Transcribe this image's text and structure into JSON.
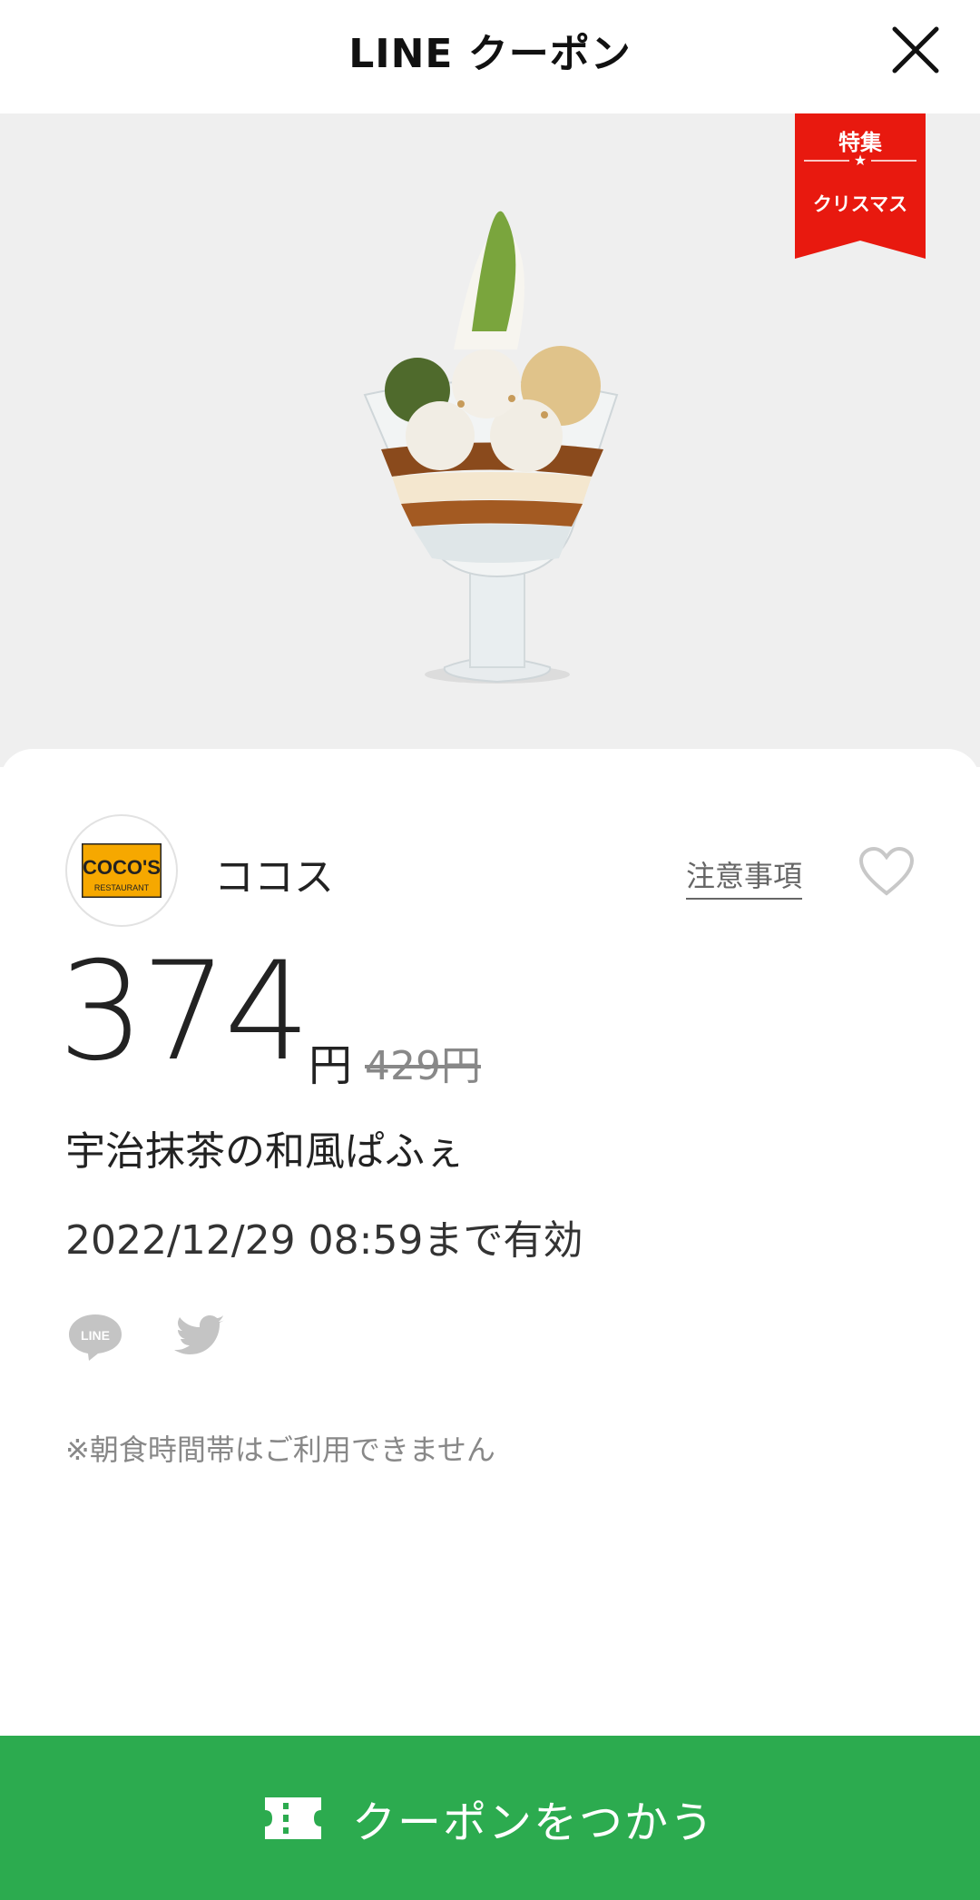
{
  "header": {
    "title": "LINE クーポン"
  },
  "hero": {
    "ribbon": {
      "line1": "特集",
      "line2": "クリスマス"
    }
  },
  "shop": {
    "name": "ココス",
    "logo_text": "COCO'S",
    "logo_subtext": "RESTAURANT"
  },
  "links": {
    "notes": "注意事項"
  },
  "coupon": {
    "price": "374",
    "currency": "円",
    "original_price": "429円",
    "item_name": "宇治抹茶の和風ぱふぇ",
    "validity": "2022/12/29  08:59まで有効",
    "note": "※朝食時間帯はご利用できません"
  },
  "share": {
    "line_icon_text": "LINE"
  },
  "cta": {
    "label": "クーポンをつかう"
  },
  "colors": {
    "accent_green": "#2cab4f",
    "ribbon_red": "#e8190f",
    "hero_bg": "#efefef"
  },
  "icons": [
    "close-icon",
    "heart-icon",
    "line-share-icon",
    "twitter-share-icon",
    "ticket-icon"
  ]
}
